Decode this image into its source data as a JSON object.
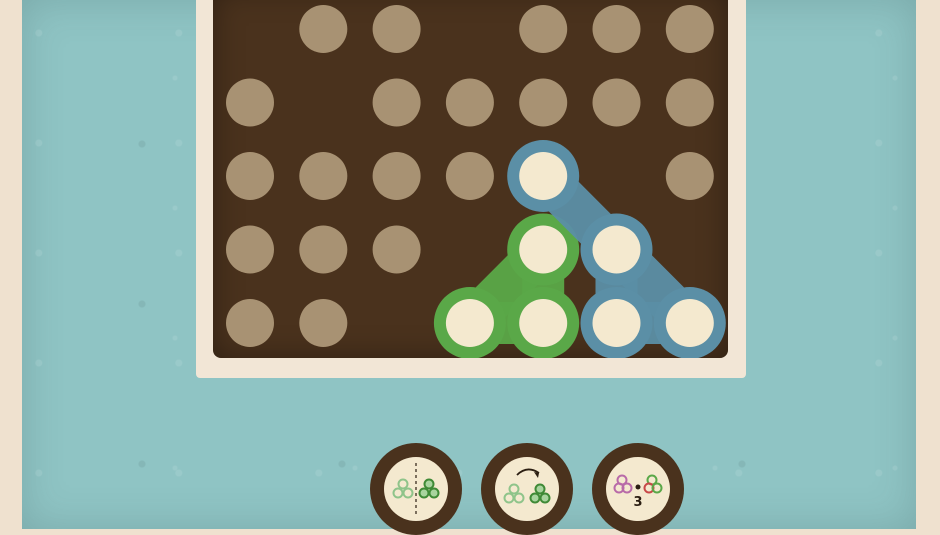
{
  "colors": {
    "background": "#efe1cf",
    "panel": "#8fc4c4",
    "board": "#4a321d",
    "frame": "#f2e6d6",
    "empty_peg": "#a89273",
    "filled_peg": "#f4e9cf",
    "piece_green": "#5aa848",
    "piece_blue": "#5b8fa6"
  },
  "board": {
    "columns": 7,
    "rows": 5,
    "cells": [
      [
        "empty",
        "peg",
        "peg",
        "empty",
        "peg",
        "peg",
        "peg"
      ],
      [
        "peg",
        "empty",
        "peg",
        "peg",
        "peg",
        "peg",
        "peg"
      ],
      [
        "peg",
        "peg",
        "peg",
        "peg",
        "blue",
        "empty",
        "peg"
      ],
      [
        "peg",
        "peg",
        "peg",
        "empty",
        "green",
        "blue",
        "empty"
      ],
      [
        "peg",
        "peg",
        "empty",
        "green",
        "green",
        "blue",
        "blue"
      ]
    ],
    "pieces": [
      {
        "color": "green",
        "cells": [
          [
            3,
            4
          ],
          [
            4,
            3
          ],
          [
            4,
            4
          ]
        ]
      },
      {
        "color": "blue",
        "cells": [
          [
            2,
            4
          ],
          [
            3,
            5
          ],
          [
            4,
            5
          ],
          [
            4,
            6
          ]
        ]
      }
    ]
  },
  "controls": [
    {
      "name": "mirror-button",
      "icon": "mirror-icon"
    },
    {
      "name": "rotate-button",
      "icon": "rotate-icon"
    },
    {
      "name": "swap-colors-button",
      "icon": "swap-colors-icon",
      "count": "3"
    }
  ]
}
